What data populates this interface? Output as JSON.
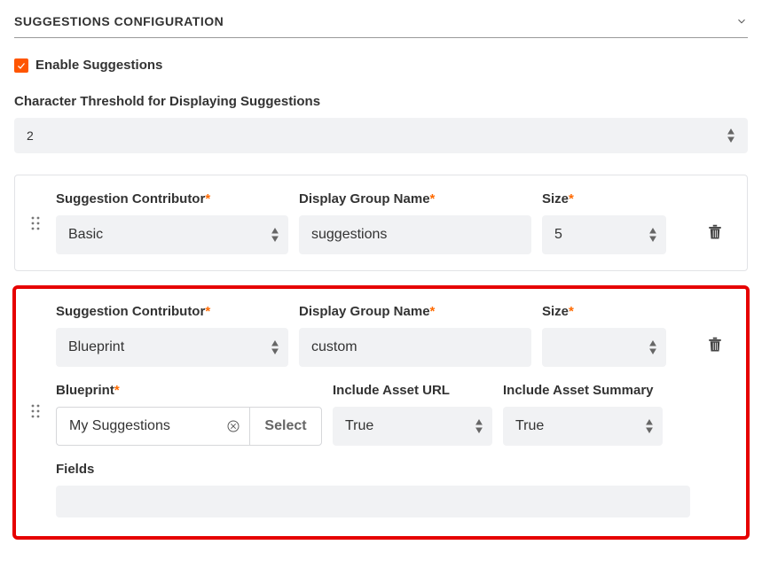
{
  "section": {
    "title": "SUGGESTIONS CONFIGURATION"
  },
  "enable": {
    "checked": true,
    "label": "Enable Suggestions"
  },
  "threshold": {
    "label": "Character Threshold for Displaying Suggestions",
    "value": "2"
  },
  "labels": {
    "suggestion_contributor": "Suggestion Contributor",
    "display_group_name": "Display Group Name",
    "size": "Size",
    "blueprint": "Blueprint",
    "include_asset_url": "Include Asset URL",
    "include_asset_summary": "Include Asset Summary",
    "fields": "Fields",
    "select": "Select"
  },
  "cards": [
    {
      "contributor": "Basic",
      "display_group_name": "suggestions",
      "size": "5"
    },
    {
      "contributor": "Blueprint",
      "display_group_name": "custom",
      "size": "",
      "blueprint": "My Suggestions",
      "include_asset_url": "True",
      "include_asset_summary": "True",
      "fields": ""
    }
  ]
}
